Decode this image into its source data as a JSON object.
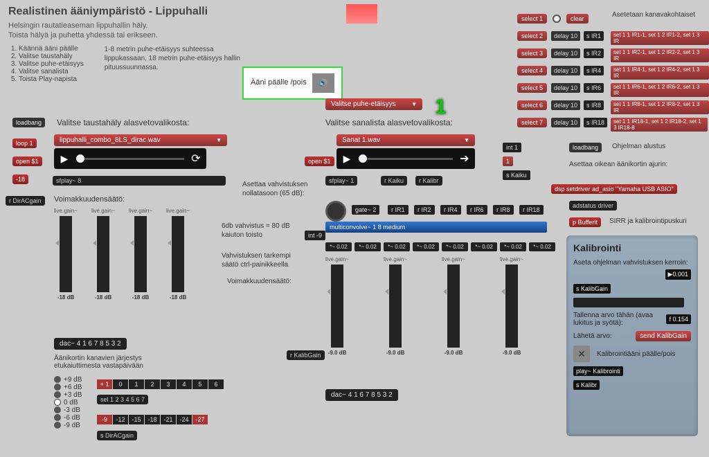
{
  "title": "Realistinen ääniympäristö - Lippuhalli",
  "subtitle1": "Helsingin rautatieaseman lippuhallin häly.",
  "subtitle2": "Toista hälyä ja puhetta yhdessä tai erikseen.",
  "instructions": [
    "Käännä ääni päälle",
    "Valitse taustahäly",
    "Valitse puhe-etäisyys",
    "Valitse sanalista",
    "Toista Play-napista"
  ],
  "instr_text": "1-8 metrin puhe-etäisyys suhteessa lippukassaan, 18 metrin puhe-etäisyys hallin pituussuunnassa.",
  "audio_toggle": "Ääni päälle /pois",
  "noise": {
    "heading": "Valitse taustahäly alasvetovalikosta:",
    "dropdown": "lippuhalli_combo_8LS_dirac.wav",
    "loadbang": "loadbang",
    "loop": "loop 1",
    "open": "open $1",
    "atten": "-18",
    "sfplay": "sfplay~ 8",
    "rdiracgain": "r DirACgain",
    "gain_heading": "Voimakkuudensäätö:",
    "gain_label": "live.gain~",
    "gain_db": "-18 dB",
    "dac": "dac~ 4 1 6 7 8 5 3 2"
  },
  "speech": {
    "dropdown_dist": "Valitse puhe-etäisyys",
    "heading": "Valitse sanalista alasvetovalikosta:",
    "dropdown_list": "Sanat 1.wav",
    "open": "open $1",
    "sfplay": "sfplay~ 1",
    "rkaiku": "r Kaiku",
    "rkalibr": "r Kalibr",
    "txt_amp": "Asettaa vahvistuksen nollatasoon (65 dB):",
    "txt_6db": "6db vahvistus = 80 dB kaiuton toisto",
    "txt_finer": "Vahvistuksen tarkempi säätö ctrl-painikkeella",
    "txt_vol": "Voimakkuudensäätö:",
    "gate": "gate~ 2",
    "big_num": "1",
    "rir": [
      "r IR1",
      "r IR2",
      "r IR4",
      "r IR6",
      "r IR8",
      "r IR18"
    ],
    "multiconv": "multiconvolve~ 1 8 medium",
    "int9": "int -9",
    "scale": "*~ 0.02",
    "gain_label": "live.gain~",
    "gain_db": "-9.0 dB",
    "rkalibgain": "r KalibGain",
    "dac": "dac~ 4 1 6 7 8 5 3 2"
  },
  "ch_order": {
    "heading": "Äänikortin kanavien järjestys etukaiuttimesta vastapäivään",
    "db_levels": [
      "+9 dB",
      "+6 dB",
      "+3 dB",
      "0 dB",
      "-3 dB",
      "-6 dB",
      "-9 dB"
    ],
    "row1": [
      "+ 1",
      "0",
      "1",
      "2",
      "3",
      "4",
      "5",
      "6"
    ],
    "sel": "sel 1 2 3 4 5 6 7",
    "row2": [
      "-9",
      "-12",
      "-15",
      "-18",
      "-21",
      "-24",
      "-27"
    ],
    "sdiracgain": "s DirACgain"
  },
  "routing": {
    "select": [
      "select 1",
      "select 2",
      "select 3",
      "select 4",
      "select 5",
      "select 6",
      "select 7"
    ],
    "clear": "clear",
    "delay": "delay 10",
    "sir": [
      "s IR1",
      "s IR2",
      "s IR4",
      "s IR6",
      "s IR8",
      "s IR18"
    ],
    "set": [
      "set 1 1 IR1-1, set 1 2 IR1-2, set 1 3 IR",
      "set 1 1 IR2-1, set 1 2 IR2-2, set 1 3 IR",
      "set 1 1 IR4-1, set 1 2 IR4-2, set 1 3 IR",
      "set 1 1 IR6-1, set 1 2 IR6-2, set 1 3 IR",
      "set 1 1 IR8-1, set 1 2 IR8-2, set 1 3 IR",
      "set 1 1 IR18-1, set 1 2 IR18-2, set 1 3 IR18-8"
    ],
    "sidebar": "Asetetaan kanavakohtaiset",
    "int1": "int 1",
    "one": "1",
    "skaiku": "s Kaiku"
  },
  "driver": {
    "loadbang": "loadbang",
    "init_label": "Ohjelman alustus",
    "driver_label": "Asettaa oikean äänikortin ajurin:",
    "dsp": "dsp setdriver ad_asio \"Yamaha USB ASIO\"",
    "adstatus": "adstatus driver",
    "pbuf": "p Bufferit",
    "buf_label": "SIRR ja kalibrointipuskuri"
  },
  "calib": {
    "title": "Kalibrointi",
    "gain_label": "Aseta ohjelman vahvistuksen kerroin:",
    "gain_val": "0.001",
    "skalib": "s KalibGain",
    "save_label": "Tallenna arvo tähän (avaa lukitus ja syötä):",
    "save_val": "f 0.154",
    "send_label": "Lähetä arvo:",
    "send_btn": "send KalibGain",
    "tone_label": "Kalibrointiääni päälle/pois",
    "play": "play~ Kalibrointi",
    "skalibr": "s Kalibr"
  }
}
